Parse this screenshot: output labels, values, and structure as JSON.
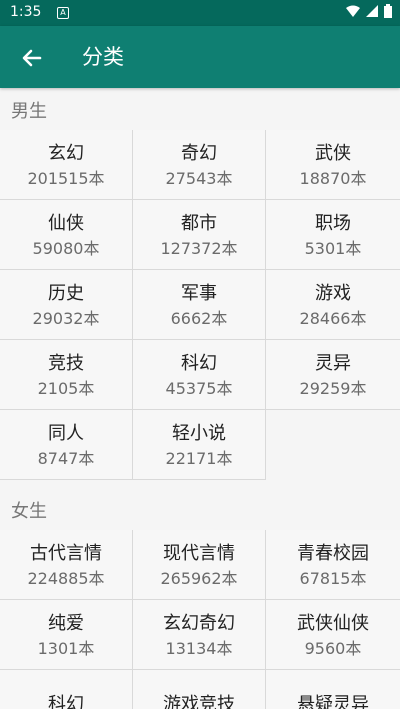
{
  "status_bar": {
    "time": "1:35",
    "notification_glyph": "A",
    "icons": [
      "wifi-icon",
      "signal-icon",
      "battery-icon"
    ]
  },
  "app_bar": {
    "title": "分类",
    "back_icon": "arrow-left-icon"
  },
  "sections": [
    {
      "title": "男生",
      "items": [
        {
          "name": "玄幻",
          "count": "201515本"
        },
        {
          "name": "奇幻",
          "count": "27543本"
        },
        {
          "name": "武侠",
          "count": "18870本"
        },
        {
          "name": "仙侠",
          "count": "59080本"
        },
        {
          "name": "都市",
          "count": "127372本"
        },
        {
          "name": "职场",
          "count": "5301本"
        },
        {
          "name": "历史",
          "count": "29032本"
        },
        {
          "name": "军事",
          "count": "6662本"
        },
        {
          "name": "游戏",
          "count": "28466本"
        },
        {
          "name": "竞技",
          "count": "2105本"
        },
        {
          "name": "科幻",
          "count": "45375本"
        },
        {
          "name": "灵异",
          "count": "29259本"
        },
        {
          "name": "同人",
          "count": "8747本"
        },
        {
          "name": "轻小说",
          "count": "22171本"
        }
      ]
    },
    {
      "title": "女生",
      "items": [
        {
          "name": "古代言情",
          "count": "224885本"
        },
        {
          "name": "现代言情",
          "count": "265962本"
        },
        {
          "name": "青春校园",
          "count": "67815本"
        },
        {
          "name": "纯爱",
          "count": "1301本"
        },
        {
          "name": "玄幻奇幻",
          "count": "13134本"
        },
        {
          "name": "武侠仙侠",
          "count": "9560本"
        },
        {
          "name": "科幻",
          "count": ""
        },
        {
          "name": "游戏竞技",
          "count": ""
        },
        {
          "name": "悬疑灵异",
          "count": ""
        }
      ]
    }
  ],
  "colors": {
    "status_bar": "#05695c",
    "app_bar": "#0f7f72",
    "background": "#f5f5f5"
  }
}
